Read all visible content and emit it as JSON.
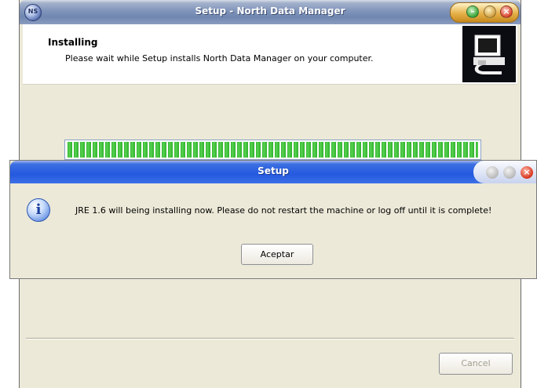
{
  "window": {
    "title": "Setup - North Data Manager",
    "app_icon": "globe-icon",
    "app_icon_text": "NS"
  },
  "header": {
    "title": "Installing",
    "subtitle": "Please wait while Setup installs North Data Manager on your computer."
  },
  "progress": {
    "value_fraction": 1.0
  },
  "footer": {
    "cancel_label": "Cancel"
  },
  "dialog": {
    "title": "Setup",
    "icon": "info-icon",
    "message": "JRE 1.6 will being installing now. Please do not restart the machine or log off until it is complete!",
    "ok_label": "Aceptar"
  },
  "colors": {
    "titlebar_inactive": "#8094ba",
    "titlebar_active": "#2459e0",
    "progress_green": "#2fb12c"
  }
}
